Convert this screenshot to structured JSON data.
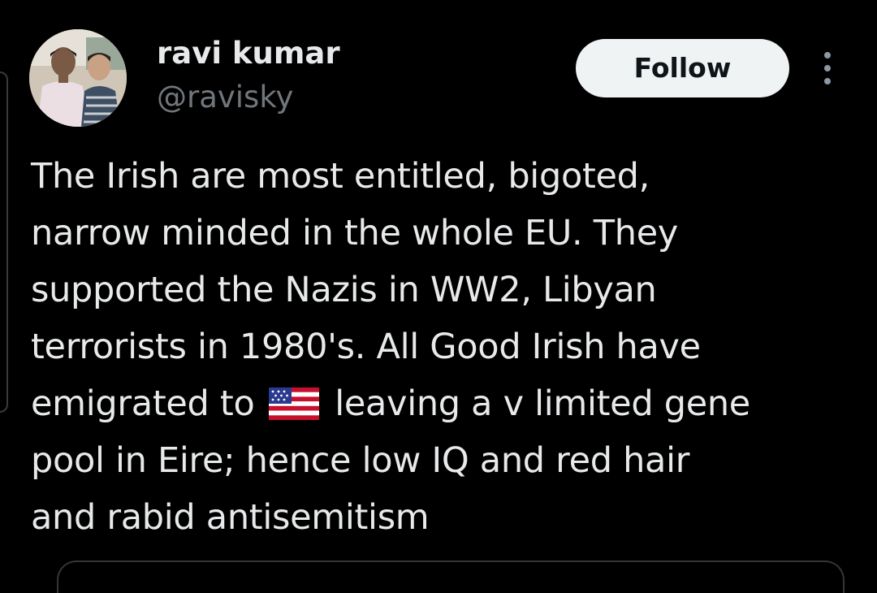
{
  "author": {
    "display_name": "ravi kumar",
    "handle": "@ravisky",
    "avatar_icon": "profile-photo"
  },
  "actions": {
    "follow_label": "Follow",
    "more_icon": "more-vertical-icon"
  },
  "tweet": {
    "lines": [
      "The Irish are most entitled, bigoted,",
      "narrow minded in the whole EU. They",
      "supported the Nazis in WW2, Libyan",
      "terrorists in 1980's. All Good Irish have"
    ],
    "line5_before": "emigrated to",
    "flag_emoji": "us-flag-emoji",
    "line5_after": "leaving a v limited gene",
    "line6": "pool in Eire; hence low IQ and red hair",
    "line7": "and rabid antisemitism"
  },
  "colors": {
    "background": "#000000",
    "text_primary": "#e7e9ea",
    "text_secondary": "#71767b",
    "follow_bg": "#eff3f4",
    "follow_text": "#0f1419"
  }
}
